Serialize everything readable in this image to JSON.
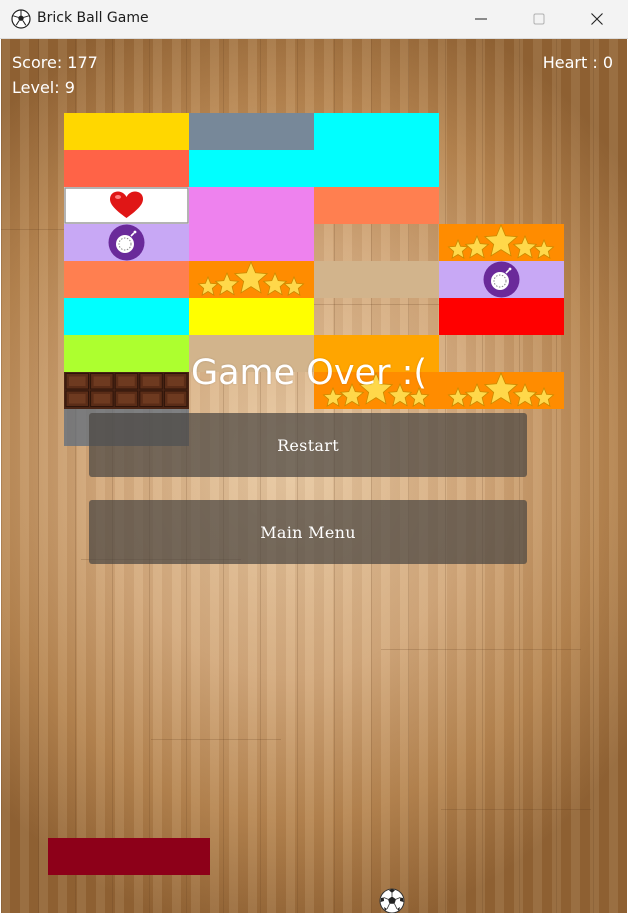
{
  "window": {
    "title": "Brick Ball Game",
    "icon": "soccer-ball-icon",
    "controls": [
      "minimize-icon",
      "maximize-icon",
      "close-icon"
    ]
  },
  "hud": {
    "score": "Score: 177",
    "level": "Level: 9",
    "heart": "Heart : 0"
  },
  "overlay": {
    "message": "Game Over :(",
    "restart_label": "Restart",
    "main_menu_label": "Main Menu"
  },
  "colors": {
    "paddle": "#8d0019",
    "overlay_button": "#4b4642"
  },
  "bricks": [
    {
      "row": 0,
      "col": 0,
      "color": "#FFD700"
    },
    {
      "row": 0,
      "col": 1,
      "color": "#778899"
    },
    {
      "row": 0,
      "col": 2,
      "color": "#00FFFF"
    },
    {
      "row": 1,
      "col": 0,
      "color": "#FF6347"
    },
    {
      "row": 1,
      "col": 1,
      "color": "#00FFFF"
    },
    {
      "row": 1,
      "col": 2,
      "color": "#00FFFF"
    },
    {
      "row": 2,
      "col": 0,
      "color": "#FFFFFF",
      "icon": "heart-icon"
    },
    {
      "row": 2,
      "col": 1,
      "color": "#EE82EE"
    },
    {
      "row": 2,
      "col": 2,
      "color": "#FF7F50"
    },
    {
      "row": 3,
      "col": 0,
      "color": "#C8A8F5",
      "icon": "bomb-icon"
    },
    {
      "row": 3,
      "col": 1,
      "color": "#EE82EE"
    },
    {
      "row": 3,
      "col": 3,
      "color": "#FF8C00",
      "icon": "stars-icon"
    },
    {
      "row": 4,
      "col": 0,
      "color": "#FF7F50"
    },
    {
      "row": 4,
      "col": 1,
      "color": "#FF8C00",
      "icon": "stars-icon"
    },
    {
      "row": 4,
      "col": 2,
      "color": "#D2B48C"
    },
    {
      "row": 4,
      "col": 3,
      "color": "#C8A8F5",
      "icon": "bomb-icon"
    },
    {
      "row": 5,
      "col": 0,
      "color": "#00FFFF"
    },
    {
      "row": 5,
      "col": 1,
      "color": "#FFFF00"
    },
    {
      "row": 5,
      "col": 3,
      "color": "#FF0000"
    },
    {
      "row": 6,
      "col": 0,
      "color": "#ADFF2F"
    },
    {
      "row": 6,
      "col": 1,
      "color": "#D2B48C"
    },
    {
      "row": 6,
      "col": 2,
      "color": "#FFA500"
    },
    {
      "row": 7,
      "col": 0,
      "color": "#4a2414",
      "icon": "chocolate-icon"
    },
    {
      "row": 7,
      "col": 2,
      "color": "#FF8C00",
      "icon": "stars-icon"
    },
    {
      "row": 7,
      "col": 3,
      "color": "#FF8C00",
      "icon": "stars-icon"
    },
    {
      "row": 8,
      "col": 0,
      "color": "#778899"
    }
  ]
}
